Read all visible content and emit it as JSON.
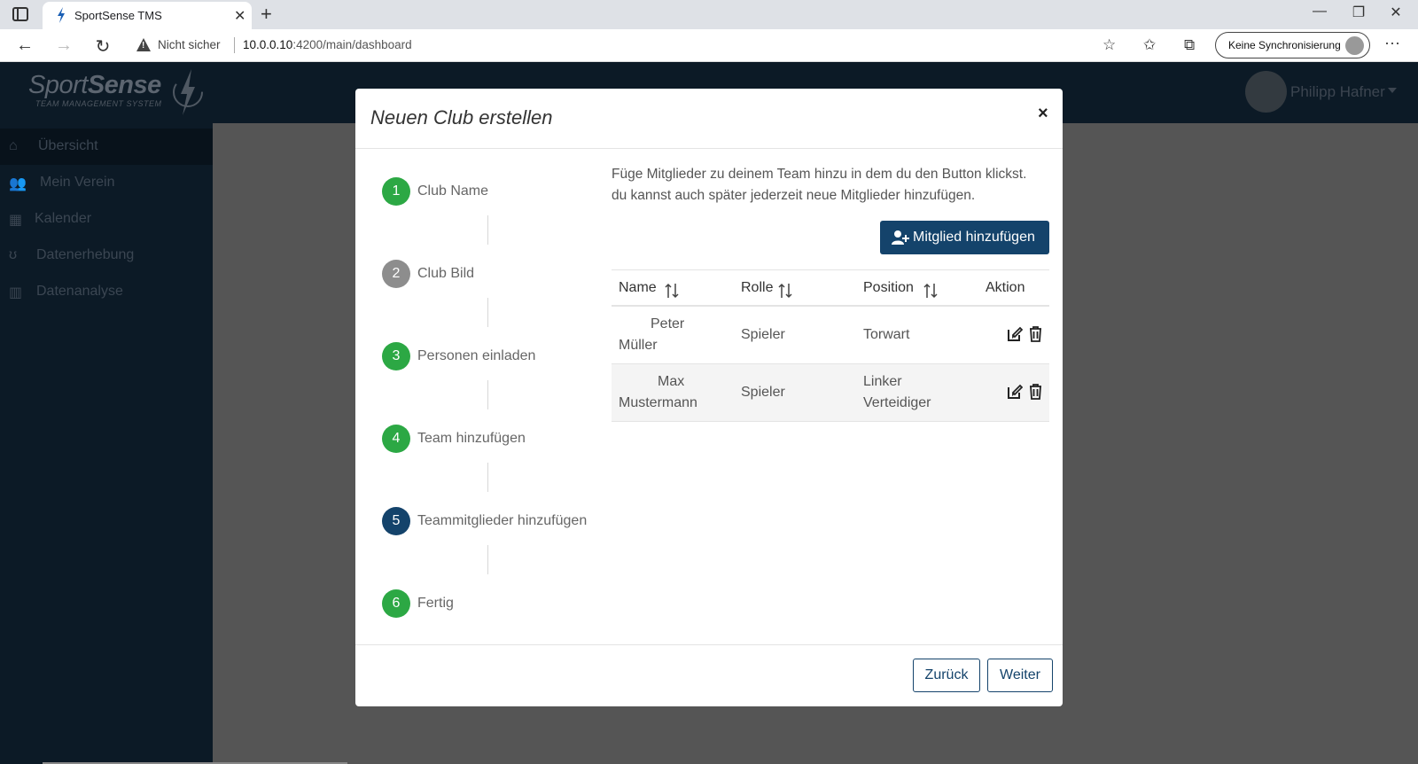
{
  "browser": {
    "tab_title": "SportSense TMS",
    "security_label": "Nicht sicher",
    "url_host": "10.0.0.10",
    "url_path": ":4200/main/dashboard",
    "sync_label": "Keine Synchronisierung"
  },
  "app": {
    "logo_main": "Sport",
    "logo_bold": "Sense",
    "logo_sub": "TEAM MANAGEMENT SYSTEM",
    "user_name": "Philipp Hafner"
  },
  "sidebar": {
    "items": [
      {
        "label": "Übersicht",
        "icon": "home-icon"
      },
      {
        "label": "Mein Verein",
        "icon": "users-icon"
      },
      {
        "label": "Kalender",
        "icon": "calendar-icon"
      },
      {
        "label": "Datenerhebung",
        "icon": "stethoscope-icon"
      },
      {
        "label": "Datenanalyse",
        "icon": "chart-icon"
      }
    ]
  },
  "modal": {
    "title": "Neuen Club erstellen",
    "close_symbol": "×",
    "steps": [
      {
        "num": "1",
        "label": "Club Name",
        "state": "done"
      },
      {
        "num": "2",
        "label": "Club Bild",
        "state": "pending"
      },
      {
        "num": "3",
        "label": "Personen einladen",
        "state": "done"
      },
      {
        "num": "4",
        "label": "Team hinzufügen",
        "state": "done"
      },
      {
        "num": "5",
        "label": "Teammitglieder hinzufügen",
        "state": "current"
      },
      {
        "num": "6",
        "label": "Fertig",
        "state": "done"
      }
    ],
    "intro_line1": "Füge Mitglieder zu deinem Team hinzu in dem du den Button klickst.",
    "intro_line2": "du kannst auch später jederzeit neue Mitglieder hinzufügen.",
    "add_button": "Mitglied hinzufügen",
    "table": {
      "headers": [
        "Name",
        "Rolle",
        "Position",
        "Aktion"
      ],
      "rows": [
        {
          "first": "Peter",
          "last": "Müller",
          "role": "Spieler",
          "pos1": "Torwart",
          "pos2": ""
        },
        {
          "first": "Max",
          "last": "Mustermann",
          "role": "Spieler",
          "pos1": "Linker",
          "pos2": "Verteidiger"
        }
      ]
    },
    "back_button": "Zurück",
    "next_button": "Weiter"
  },
  "colors": {
    "primary": "#14436b",
    "step_done": "#2ca844",
    "step_pending": "#8d8d8d",
    "sidebar_bg": "#0c1a26"
  }
}
